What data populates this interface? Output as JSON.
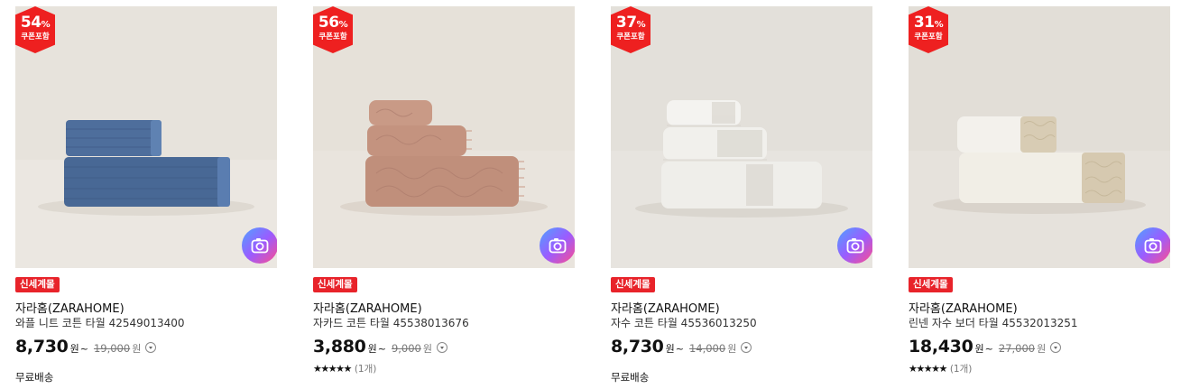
{
  "products": [
    {
      "discount": "54",
      "percent_sign": "%",
      "coupon_label": "쿠폰포함",
      "tag": "신세계몰",
      "brand": "자라홈(ZARAHOME)",
      "name": "와플 니트 코튼 타월 42549013400",
      "price": "8,730",
      "won": "원",
      "tilde": "~",
      "original_price": "19,000",
      "original_won": "원",
      "shipping": "무료배송",
      "image": "blue waffle knit cotton towels",
      "towel_color": "#4e6e9c"
    },
    {
      "discount": "56",
      "percent_sign": "%",
      "coupon_label": "쿠폰포함",
      "tag": "신세계몰",
      "brand": "자라홈(ZARAHOME)",
      "name": "자카드 코튼 타월 45538013676",
      "price": "3,880",
      "won": "원",
      "tilde": "~",
      "original_price": "9,000",
      "original_won": "원",
      "stars": "★★★★★",
      "review_count": "(1개)",
      "image": "pink jacquard cotton towels",
      "towel_color": "#c99a86"
    },
    {
      "discount": "37",
      "percent_sign": "%",
      "coupon_label": "쿠폰포함",
      "tag": "신세계몰",
      "brand": "자라홈(ZARAHOME)",
      "name": "자수 코튼 타월 45536013250",
      "price": "8,730",
      "won": "원",
      "tilde": "~",
      "original_price": "14,000",
      "original_won": "원",
      "shipping": "무료배송",
      "image": "white embroidered cotton towels",
      "towel_color": "#f2f1ee"
    },
    {
      "discount": "31",
      "percent_sign": "%",
      "coupon_label": "쿠폰포함",
      "tag": "신세계몰",
      "brand": "자라홈(ZARAHOME)",
      "name": "린넨 자수 보더 타월 45532013251",
      "price": "18,430",
      "won": "원",
      "tilde": "~",
      "original_price": "27,000",
      "original_won": "원",
      "stars": "★★★★★",
      "review_count": "(1개)",
      "image": "ecru towels with linen embroidered border",
      "towel_color": "#f1eee6"
    }
  ],
  "colors": {
    "badge": "#ee2020",
    "tag": "#e8232a",
    "image_bg": "#e9e5df"
  },
  "icons": {
    "camera": "camera-icon",
    "info": "chevron-down-circle-icon"
  }
}
